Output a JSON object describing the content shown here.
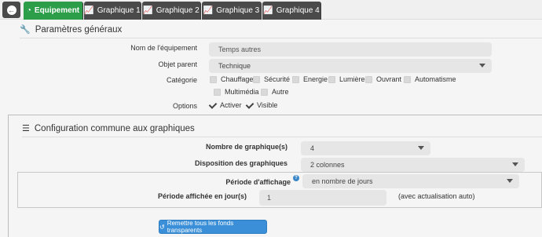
{
  "tabs": [
    {
      "label": "Equipement",
      "icon": "gauge-icon",
      "active": true
    },
    {
      "label": "Graphique 1",
      "icon": "chart-line-icon"
    },
    {
      "label": "Graphique 2",
      "icon": "chart-line-icon"
    },
    {
      "label": "Graphique 3",
      "icon": "chart-line-icon"
    },
    {
      "label": "Graphique 4",
      "icon": "chart-line-icon"
    }
  ],
  "general": {
    "title": "Paramètres généraux",
    "name_label": "Nom de l'équipement",
    "name_value": "Temps autres",
    "parent_label": "Objet parent",
    "parent_value": "Technique",
    "category_label": "Catégorie",
    "categories": [
      "Chauffage",
      "Sécurité",
      "Energie",
      "Lumière",
      "Ouvrant",
      "Automatisme",
      "Multimédia",
      "Autre"
    ],
    "options_label": "Options",
    "options": [
      "Activer",
      "Visible"
    ]
  },
  "graph_config": {
    "title": "Configuration commune aux graphiques",
    "count_label": "Nombre de graphique(s)",
    "count_value": "4",
    "layout_label": "Disposition des graphiques",
    "layout_value": "2 colonnes",
    "period_label": "Période d'affichage",
    "period_value": "en nombre de jours",
    "days_label": "Période affichée en jour(s)",
    "days_value": "1",
    "days_note": "(avec actualisation auto)",
    "reset_button": "Remettre tous les fonds transparents"
  },
  "colors": {
    "active_tab": "#2c9e4a",
    "tab": "#4a4a4a",
    "button": "#3a8fd8"
  }
}
